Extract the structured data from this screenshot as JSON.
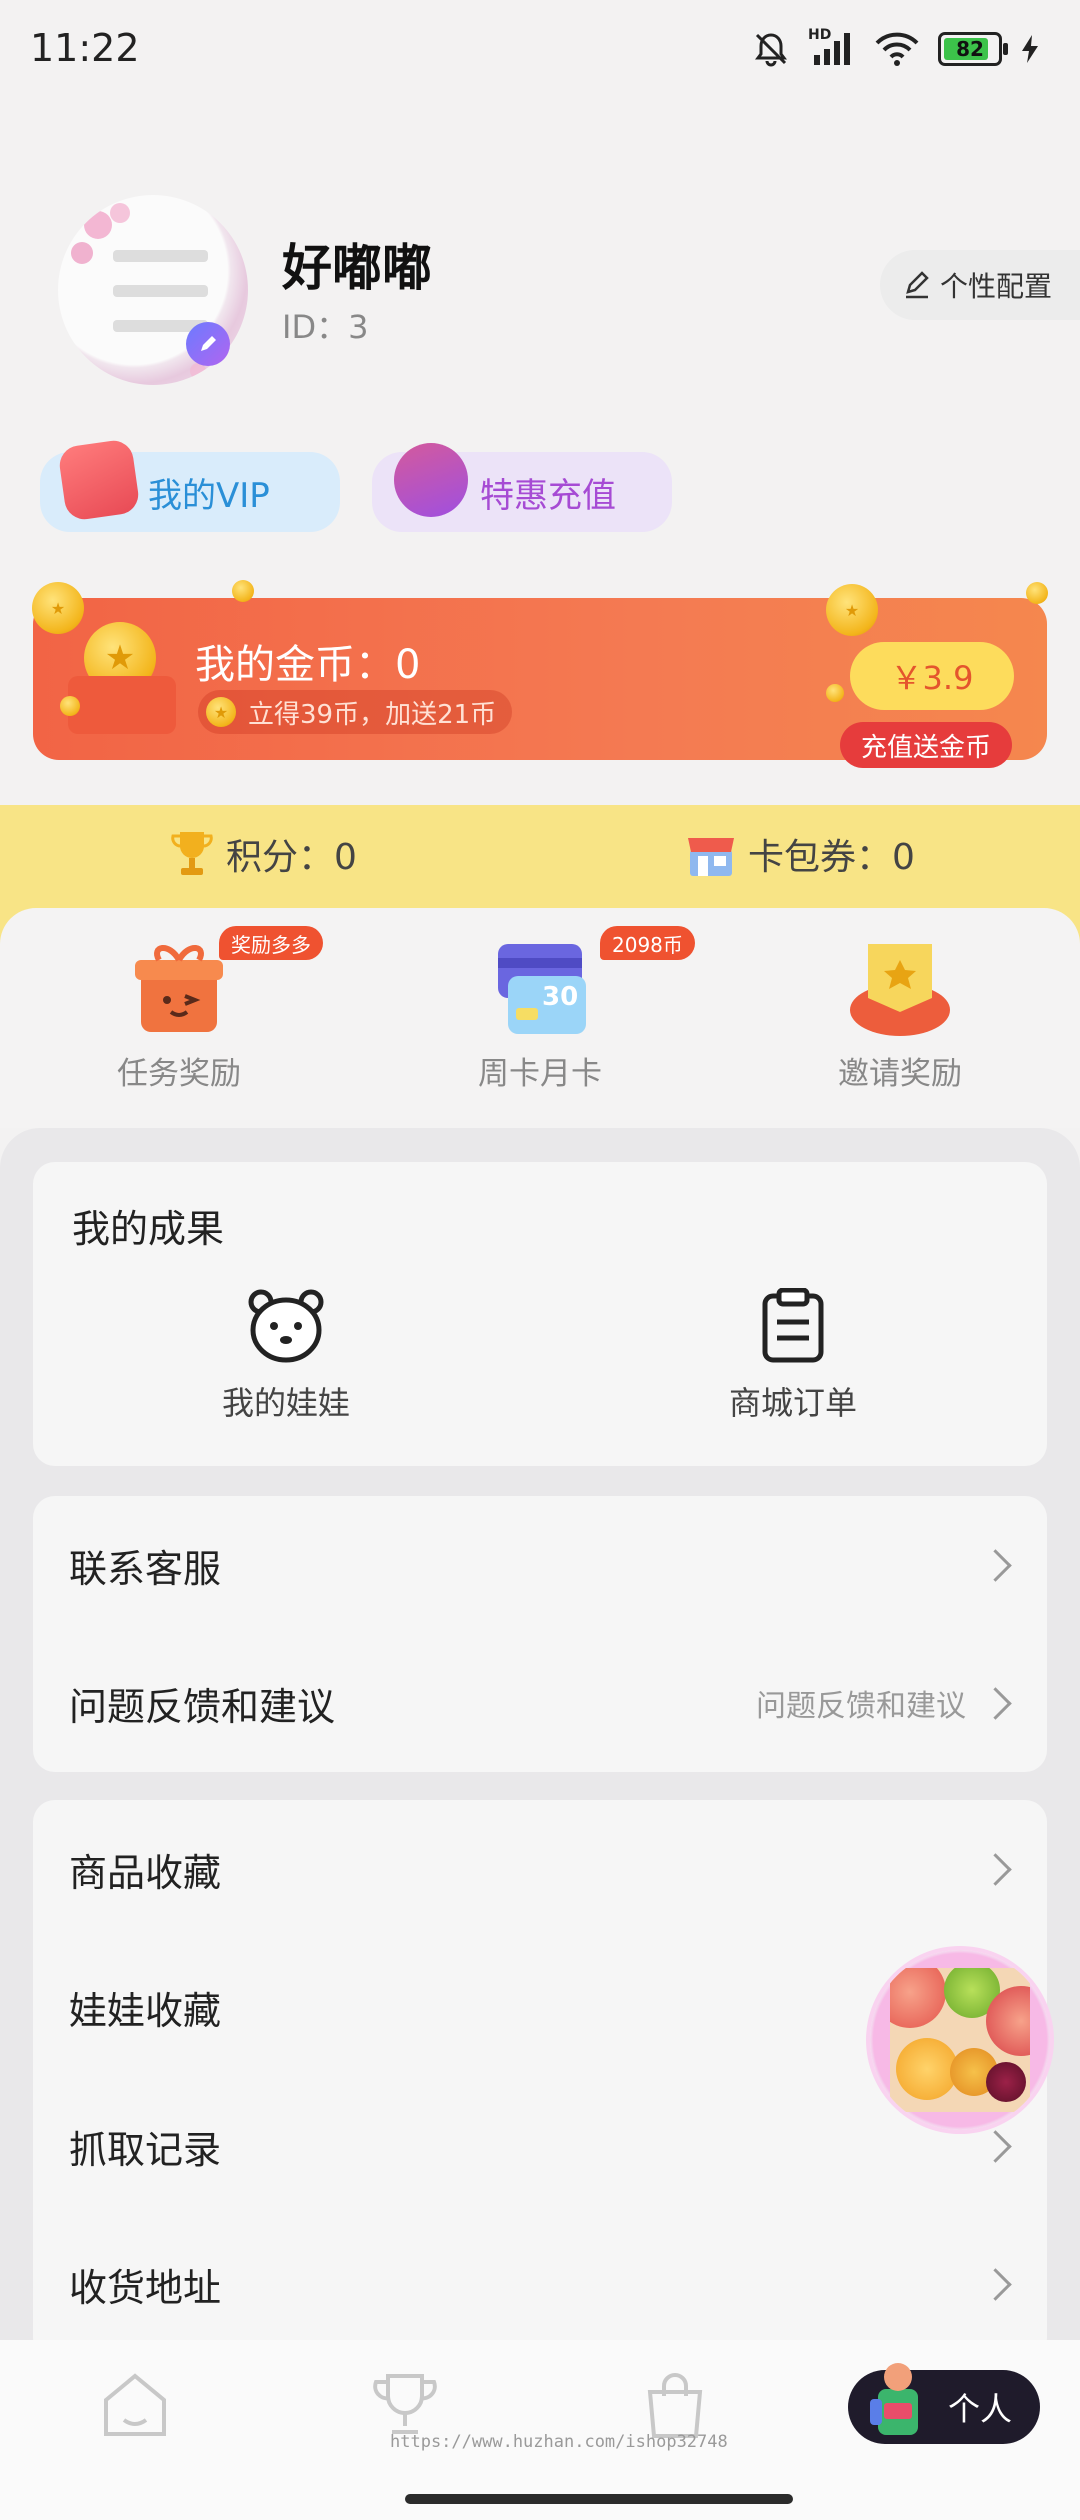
{
  "status_bar": {
    "time": "11:22",
    "battery": "82",
    "network": "HD"
  },
  "profile": {
    "name": "好嘟嘟",
    "id_label": "ID：3",
    "personal_config": "个性配置",
    "vip_label": "我的VIP",
    "recharge_label": "特惠充值"
  },
  "gold": {
    "title": "我的金币：0",
    "subtitle": "立得39币，加送21币",
    "price": "￥3.9",
    "tag": "充值送金币"
  },
  "points": {
    "score_label": "积分：0",
    "coupon_label": "卡包券：0"
  },
  "shortcuts": [
    {
      "label": "任务奖励",
      "badge": "奖励多多"
    },
    {
      "label": "周卡月卡",
      "badge": "2098币",
      "card_number": "30"
    },
    {
      "label": "邀请奖励",
      "badge": ""
    }
  ],
  "achievements": {
    "title": "我的成果",
    "items": [
      {
        "label": "我的娃娃",
        "icon": "bear-icon"
      },
      {
        "label": "商城订单",
        "icon": "clipboard-icon"
      }
    ]
  },
  "menu_group1": [
    {
      "label": "联系客服",
      "value": ""
    },
    {
      "label": "问题反馈和建议",
      "value": "问题反馈和建议"
    }
  ],
  "menu_group2": [
    {
      "label": "商品收藏"
    },
    {
      "label": "娃娃收藏"
    },
    {
      "label": "抓取记录"
    },
    {
      "label": "收货地址"
    }
  ],
  "bottom_nav": {
    "active_label": "个人"
  },
  "watermark": "https://www.huzhan.com/ishop32748",
  "colors": {
    "gold_card": "#f26445",
    "points_strip": "#f8e486",
    "vip": "#2a8fd7",
    "recharge": "#a64bd4"
  }
}
